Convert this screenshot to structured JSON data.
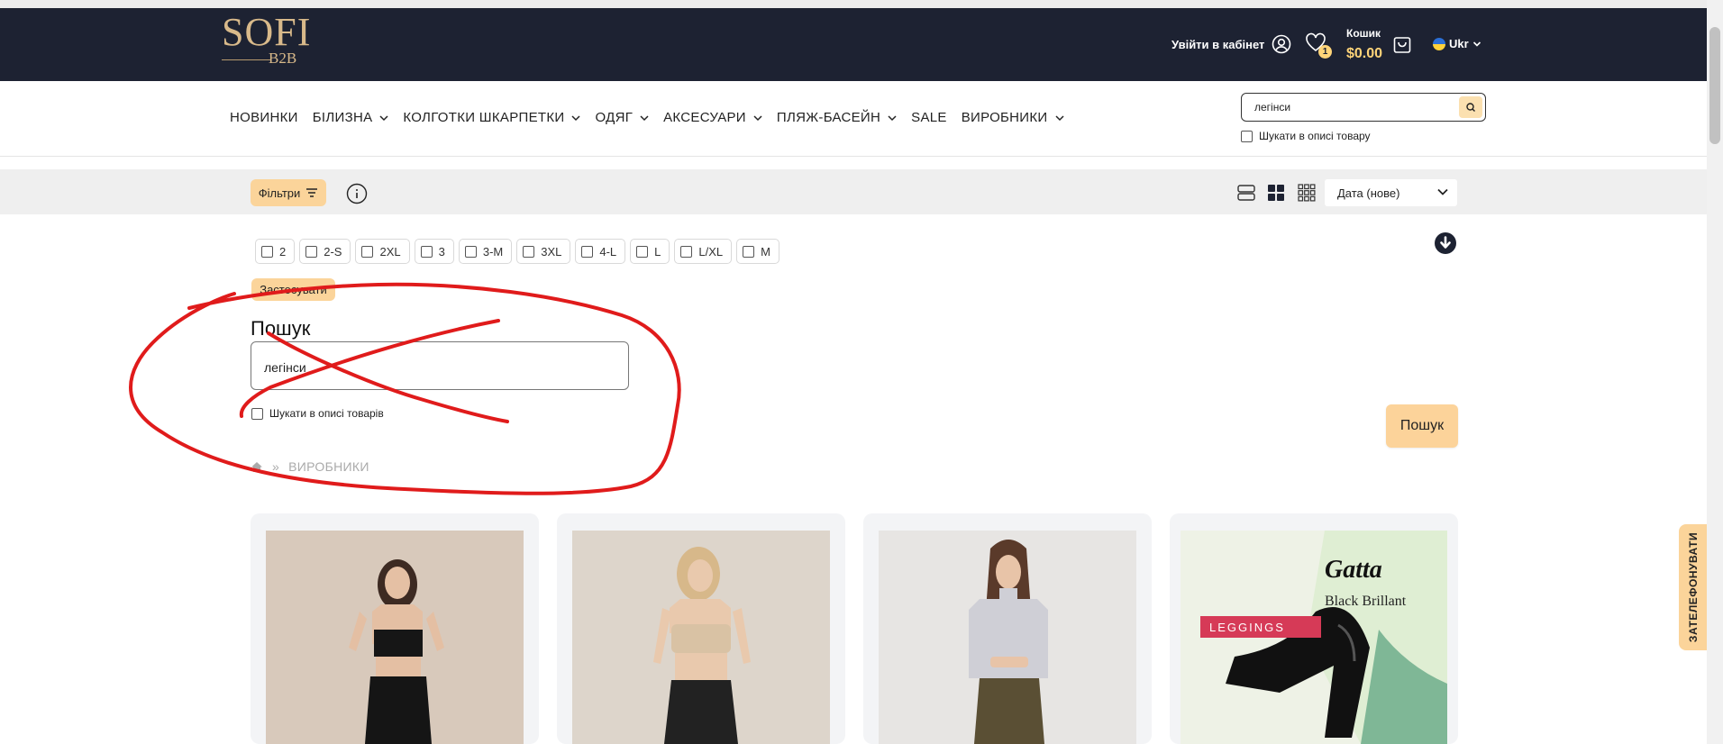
{
  "header": {
    "logo_main": "SOFI",
    "logo_sub": "B2B",
    "login_label": "Увійти в кабінет",
    "wishlist_count": "1",
    "cart_label": "Кошик",
    "cart_total": "$0.00",
    "language": "Ukr"
  },
  "nav": {
    "items": [
      {
        "label": "НОВИНКИ",
        "dropdown": false
      },
      {
        "label": "БІЛИЗНА",
        "dropdown": true
      },
      {
        "label": "КОЛГОТКИ ШКАРПЕТКИ",
        "dropdown": true
      },
      {
        "label": "ОДЯГ",
        "dropdown": true
      },
      {
        "label": "АКСЕСУАРИ",
        "dropdown": true
      },
      {
        "label": "ПЛЯЖ-БАСЕЙН",
        "dropdown": true
      },
      {
        "label": "SALE",
        "dropdown": false
      },
      {
        "label": "ВИРОБНИКИ",
        "dropdown": true
      }
    ]
  },
  "top_search": {
    "value": "легінси",
    "description_label": "Шукати в описі товару"
  },
  "toolbar": {
    "filters_label": "Фільтри",
    "sort_label": "Дата (нове)"
  },
  "filters": {
    "sizes": [
      "2",
      "2-S",
      "2XL",
      "3",
      "3-M",
      "3XL",
      "4-L",
      "L",
      "L/XL",
      "M"
    ],
    "apply_label": "Застосувати"
  },
  "search_block": {
    "title": "Пошук",
    "value": "легінси",
    "description_label": "Шукати в описі товарів",
    "button_label": "Пошук"
  },
  "breadcrumb": {
    "current": "ВИРОБНИКИ"
  },
  "products": [
    {
      "image": "model-black-crop-top"
    },
    {
      "image": "model-beige-sports-bra"
    },
    {
      "image": "model-grey-turtleneck"
    },
    {
      "image": "gatta-leggings-ad",
      "brand": "Gatta",
      "product_line": "Black Brillant",
      "tag": "LEGGINGS"
    }
  ],
  "callback_tab": "ЗАТЕЛЕФОНУВАТИ",
  "colors": {
    "header_bg": "#1d2232",
    "accent": "#fbd49a",
    "annotation": "#e01b1b"
  }
}
